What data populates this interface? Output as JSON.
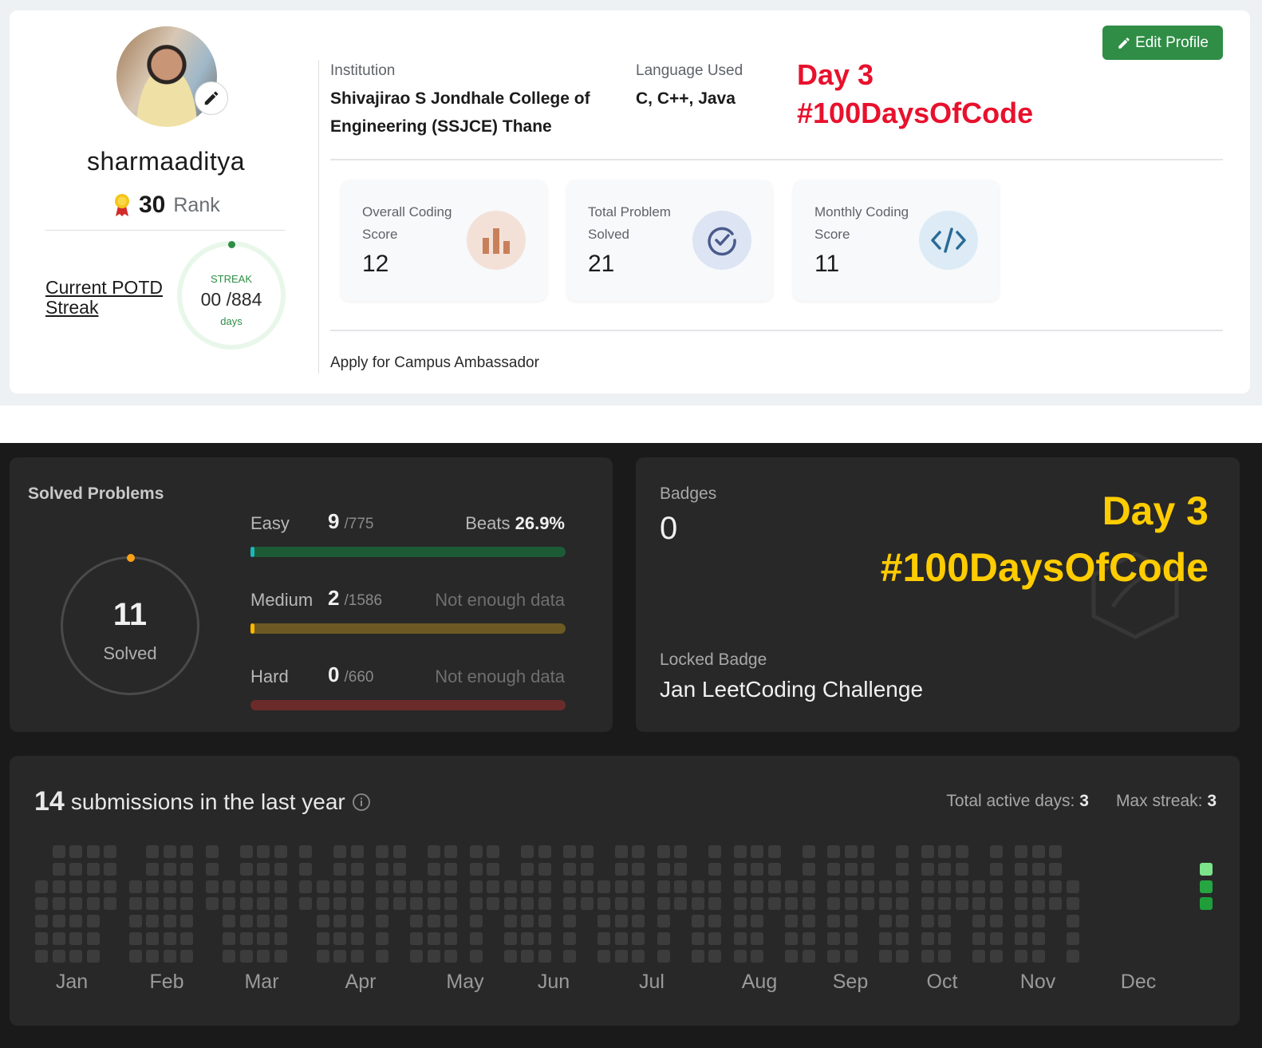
{
  "gfg": {
    "username": "sharmaaditya",
    "rank_value": "30",
    "rank_label": "Rank",
    "potd_label": "Current POTD Streak",
    "streak_label": "STREAK",
    "streak_value": "00 /884",
    "streak_unit": "days",
    "institution_label": "Institution",
    "institution_value": "Shivajirao S Jondhale College of Engineering (SSJCE) Thane",
    "language_label": "Language Used",
    "language_value": "C, C++, Java",
    "overlay_line1": "Day 3",
    "overlay_line2": "#100DaysOfCode",
    "edit_button": "Edit Profile",
    "stats": [
      {
        "label": "Overall Coding Score",
        "value": "12",
        "icon": "bar-chart-icon"
      },
      {
        "label": "Total Problem Solved",
        "value": "21",
        "icon": "check-circle-icon"
      },
      {
        "label": "Monthly Coding Score",
        "value": "11",
        "icon": "code-icon"
      }
    ],
    "ambassador_link": "Apply for Campus Ambassador",
    "accent_color": "#2f8d46",
    "overlay_color": "#e8112d"
  },
  "leetcode": {
    "solved_title": "Solved Problems",
    "solved_count": "11",
    "solved_label": "Solved",
    "difficulties": [
      {
        "name": "Easy",
        "solved": "9",
        "total": "/775",
        "right_label": "Beats",
        "right_value": "26.9%",
        "fill_fraction": 0.012,
        "color": "#1cb8b8",
        "track": "#1d5b37"
      },
      {
        "name": "Medium",
        "solved": "2",
        "total": "/1586",
        "right_label": "Not enough data",
        "right_value": "",
        "fill_fraction": 0.0013,
        "color": "#ffb700",
        "track": "#6b5a23"
      },
      {
        "name": "Hard",
        "solved": "0",
        "total": "/660",
        "right_label": "Not enough data",
        "right_value": "",
        "fill_fraction": 0,
        "color": "#f63737",
        "track": "#6b2b2b"
      }
    ],
    "badges_title": "Badges",
    "badges_count": "0",
    "locked_label": "Locked Badge",
    "locked_name": "Jan LeetCoding Challenge",
    "overlay_line1": "Day 3",
    "overlay_line2": "#100DaysOfCode",
    "overlay_color": "#ffcc00",
    "submissions_count": "14",
    "submissions_text": "submissions in the last year",
    "active_days_label": "Total active days:",
    "active_days_value": "3",
    "max_streak_label": "Max streak:",
    "max_streak_value": "3",
    "months": [
      "Jan",
      "Feb",
      "Mar",
      "Apr",
      "May",
      "Jun",
      "Jul",
      "Aug",
      "Sep",
      "Oct",
      "Nov",
      "Dec"
    ]
  }
}
